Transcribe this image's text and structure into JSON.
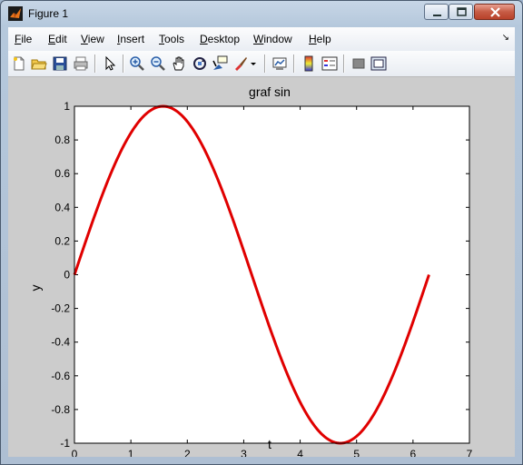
{
  "window": {
    "title": "Figure 1",
    "buttons": [
      "minimize",
      "maximize",
      "close"
    ]
  },
  "menubar": {
    "items": [
      {
        "label": "File",
        "key": "F",
        "rest": "ile"
      },
      {
        "label": "Edit",
        "key": "E",
        "rest": "dit"
      },
      {
        "label": "View",
        "key": "V",
        "rest": "iew"
      },
      {
        "label": "Insert",
        "key": "I",
        "rest": "nsert"
      },
      {
        "label": "Tools",
        "key": "T",
        "rest": "ools"
      },
      {
        "label": "Desktop",
        "key": "D",
        "rest": "esktop"
      },
      {
        "label": "Window",
        "key": "W",
        "rest": "indow"
      },
      {
        "label": "Help",
        "key": "H",
        "rest": "elp"
      }
    ]
  },
  "toolbar": {
    "icons": [
      "new-figure-icon",
      "open-file-icon",
      "save-icon",
      "print-icon",
      "edit-plot-icon",
      "zoom-in-icon",
      "zoom-out-icon",
      "pan-icon",
      "rotate-3d-icon",
      "data-cursor-icon",
      "brush-icon",
      "brush-dropdown-icon",
      "link-plot-icon",
      "insert-colorbar-icon",
      "insert-legend-icon",
      "hide-plot-tools-icon",
      "show-plot-tools-icon"
    ]
  },
  "chart_data": {
    "type": "line",
    "title": "graf sin",
    "xlabel": "t",
    "ylabel": "y",
    "xlim": [
      0,
      7
    ],
    "ylim": [
      -1,
      1
    ],
    "xticks": [
      "0",
      "1",
      "2",
      "3",
      "4",
      "5",
      "6",
      "7"
    ],
    "yticks": [
      "1",
      "0.8",
      "0.6",
      "0.4",
      "0.2",
      "0",
      "-0.2",
      "-0.4",
      "-0.6",
      "-0.8",
      "-1"
    ],
    "grid": false,
    "series": [
      {
        "function": "sin(t)",
        "x_range": [
          0,
          6.2832
        ],
        "color": "#e00000"
      }
    ],
    "colors": {
      "line": "#e00000",
      "figure_bg": "#cccccc",
      "axes_bg": "#ffffff"
    }
  }
}
